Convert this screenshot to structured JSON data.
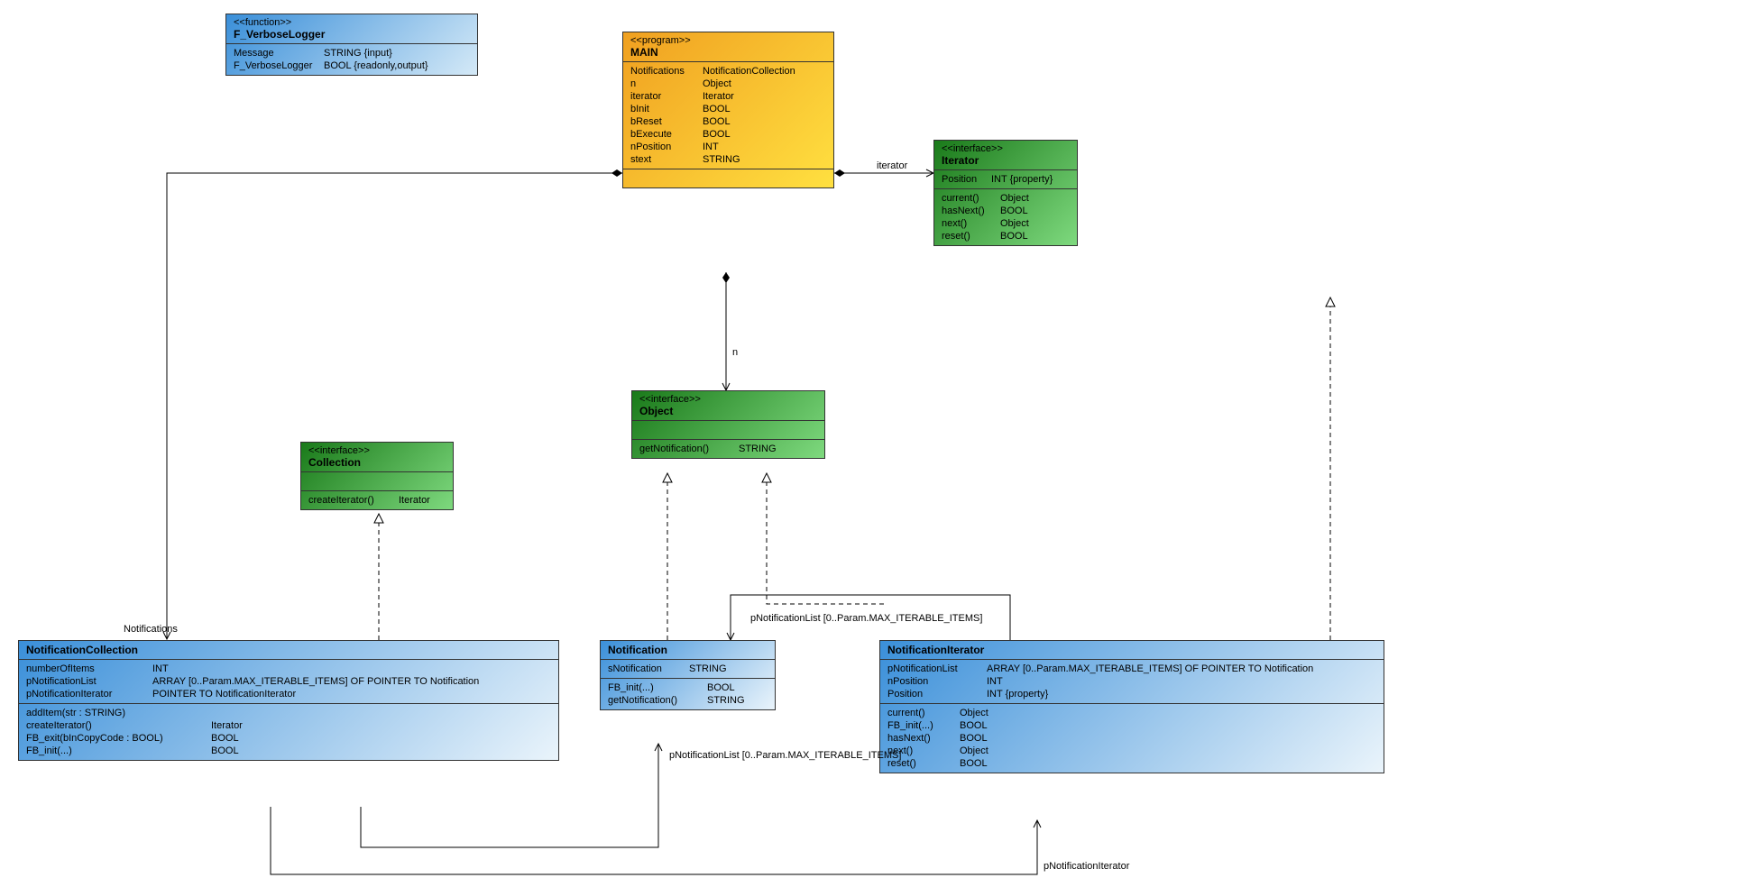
{
  "f_verbose": {
    "stereo": "<<function>>",
    "title": "F_VerboseLogger",
    "rows": [
      {
        "name": "Message",
        "type": "STRING {input}"
      },
      {
        "name": "F_VerboseLogger",
        "type": "BOOL {readonly,output}"
      }
    ]
  },
  "main": {
    "stereo": "<<program>>",
    "title": "MAIN",
    "rows": [
      {
        "name": "Notifications",
        "type": "NotificationCollection"
      },
      {
        "name": "n",
        "type": "Object"
      },
      {
        "name": "iterator",
        "type": "Iterator"
      },
      {
        "name": "bInit",
        "type": "BOOL"
      },
      {
        "name": "bReset",
        "type": "BOOL"
      },
      {
        "name": "bExecute",
        "type": "BOOL"
      },
      {
        "name": "nPosition",
        "type": "INT"
      },
      {
        "name": "stext",
        "type": "STRING"
      }
    ]
  },
  "iterator": {
    "stereo": "<<interface>>",
    "title": "Iterator",
    "props": [
      {
        "name": "Position",
        "type": "INT {property}"
      }
    ],
    "methods": [
      {
        "name": "current()",
        "type": "Object"
      },
      {
        "name": "hasNext()",
        "type": "BOOL"
      },
      {
        "name": "next()",
        "type": "Object"
      },
      {
        "name": "reset()",
        "type": "BOOL"
      }
    ]
  },
  "collection": {
    "stereo": "<<interface>>",
    "title": "Collection",
    "methods": [
      {
        "name": "createIterator()",
        "type": "Iterator"
      }
    ]
  },
  "object": {
    "stereo": "<<interface>>",
    "title": "Object",
    "methods": [
      {
        "name": "getNotification()",
        "type": "STRING"
      }
    ]
  },
  "notif_coll": {
    "title": "NotificationCollection",
    "props": [
      {
        "name": "numberOfItems",
        "type": "INT"
      },
      {
        "name": "pNotificationList",
        "type": "ARRAY [0..Param.MAX_ITERABLE_ITEMS] OF POINTER TO Notification"
      },
      {
        "name": "pNotificationIterator",
        "type": "POINTER TO NotificationIterator"
      }
    ],
    "methods": [
      {
        "name": "addItem(str : STRING)",
        "type": ""
      },
      {
        "name": "createIterator()",
        "type": "Iterator"
      },
      {
        "name": "FB_exit(bInCopyCode : BOOL)",
        "type": "BOOL"
      },
      {
        "name": "FB_init(...)",
        "type": "BOOL"
      }
    ]
  },
  "notification": {
    "title": "Notification",
    "props": [
      {
        "name": "sNotification",
        "type": "STRING"
      }
    ],
    "methods": [
      {
        "name": "FB_init(...)",
        "type": "BOOL"
      },
      {
        "name": "getNotification()",
        "type": "STRING"
      }
    ]
  },
  "notif_iter": {
    "title": "NotificationIterator",
    "props": [
      {
        "name": "pNotificationList",
        "type": "ARRAY [0..Param.MAX_ITERABLE_ITEMS] OF POINTER TO Notification"
      },
      {
        "name": "nPosition",
        "type": "INT"
      },
      {
        "name": "Position",
        "type": "INT {property}"
      }
    ],
    "methods": [
      {
        "name": "current()",
        "type": "Object"
      },
      {
        "name": "FB_init(...)",
        "type": "BOOL"
      },
      {
        "name": "hasNext()",
        "type": "BOOL"
      },
      {
        "name": "next()",
        "type": "Object"
      },
      {
        "name": "reset()",
        "type": "BOOL"
      }
    ]
  },
  "labels": {
    "iterator": "iterator",
    "n": "n",
    "notifications": "Notifications",
    "pNotifList1": "pNotificationList [0..Param.MAX_ITERABLE_ITEMS]",
    "pNotifList2": "pNotificationList [0..Param.MAX_ITERABLE_ITEMS]",
    "pNotifIter": "pNotificationIterator"
  }
}
